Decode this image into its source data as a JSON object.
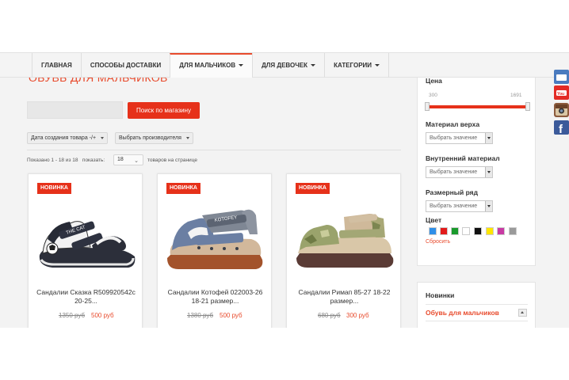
{
  "nav": {
    "items": [
      {
        "label": "Главная",
        "dropdown": false,
        "active": false
      },
      {
        "label": "Способы доставки",
        "dropdown": false,
        "active": false
      },
      {
        "label": "Для мальчиков",
        "dropdown": true,
        "active": true
      },
      {
        "label": "Для девочек",
        "dropdown": true,
        "active": false
      },
      {
        "label": "Категории",
        "dropdown": true,
        "active": false
      }
    ]
  },
  "page": {
    "heading": "ОБУВЬ ДЛЯ МАЛЬЧИКОВ"
  },
  "search": {
    "value": "",
    "button_label": "Поиск по магазину"
  },
  "sorting": {
    "date_label": "Дата создания товара -/+",
    "manufacturer_label": "Выбрать производителя"
  },
  "pagination": {
    "shown_text": "Показано 1 - 18 из 18",
    "show_label": "показать:",
    "per_page": "18",
    "suffix": "товаров на странице"
  },
  "products": [
    {
      "badge": "НОВИНКА",
      "title": "Сандалии Сказка R509920542c 20-25...",
      "old_price": "1350 руб",
      "price": "500 руб",
      "icon": "sandal-black-white"
    },
    {
      "badge": "НОВИНКА",
      "title": "Сандалии Котофей 022003-26 18-21 размер...",
      "old_price": "1380 руб",
      "price": "500 руб",
      "icon": "sandal-blue-grey"
    },
    {
      "badge": "НОВИНКА",
      "title": "Сандалии Римап 85-27 18-22 размер...",
      "old_price": "680 руб",
      "price": "300 руб",
      "icon": "sandal-beige-camo"
    }
  ],
  "filter": {
    "price_label": "Цена",
    "price_min": "300",
    "price_max": "1691",
    "upper_material_label": "Материал верха",
    "inner_material_label": "Внутренний материал",
    "size_label": "Размерный ряд",
    "select_placeholder": "Выбрать значение",
    "color_label": "Цвет",
    "colors": [
      "#2f8fe8",
      "#e21b1b",
      "#1a9a2c",
      "#ffffff",
      "#111111",
      "#ffe600",
      "#c83aa3",
      "#9a9a9a"
    ],
    "reset_label": "Сбросить"
  },
  "new_box": {
    "title": "Новинки",
    "link": "Обувь для мальчиков"
  },
  "social": [
    "share-icon",
    "youtube-icon",
    "instagram-icon",
    "facebook-icon"
  ],
  "colors": {
    "accent": "#e6311a",
    "link": "#e84b2d"
  }
}
